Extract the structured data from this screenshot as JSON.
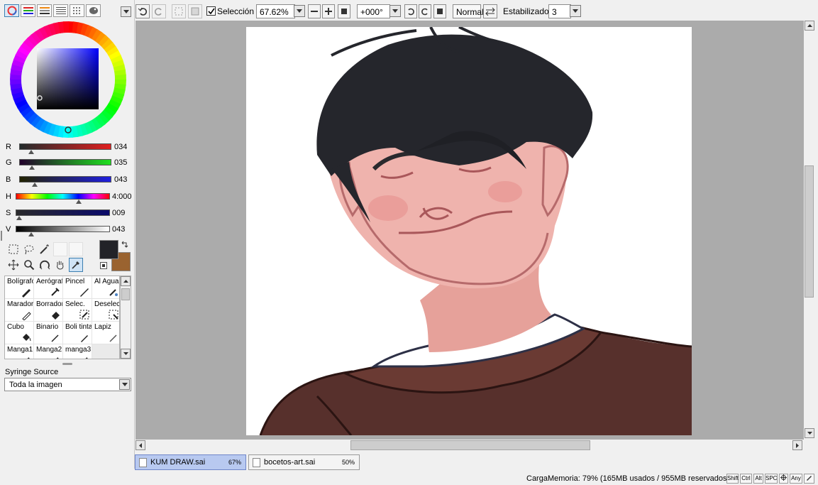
{
  "colors": {
    "panel_bg": "#f0f0f0",
    "canvas_bg": "#ababab",
    "foreground": "#222328",
    "background": "#9a6330",
    "active_tab": "#b8c9f0",
    "accent": "#3c7fb1"
  },
  "color_panel": {
    "mode_icons": [
      "color-wheel-icon",
      "rgb-slider-icon",
      "hsv-slider-icon",
      "swatch-list-icon",
      "scratchpad-icon",
      "palette-icon"
    ],
    "sliders": [
      {
        "label": "R",
        "value": "034",
        "level": 0.133
      },
      {
        "label": "G",
        "value": "035",
        "level": 0.137
      },
      {
        "label": "B",
        "value": "043",
        "level": 0.169
      },
      {
        "label": "H",
        "value": "4:000",
        "level": 0.667
      },
      {
        "label": "S",
        "value": "009",
        "level": 0.035
      },
      {
        "label": "V",
        "value": "043",
        "level": 0.169
      }
    ]
  },
  "tools": [
    "selection-rect-tool",
    "lasso-tool",
    "magic-wand-tool",
    "move-tool",
    "zoom-tool",
    "rotate-tool",
    "hand-tool",
    "eyedropper-tool"
  ],
  "brushes": [
    {
      "name": "Bolígrafo"
    },
    {
      "name": "Aerógrafo"
    },
    {
      "name": "Pincel"
    },
    {
      "name": "Al Agua"
    },
    {
      "name": "Marador"
    },
    {
      "name": "Borrador"
    },
    {
      "name": "Selec."
    },
    {
      "name": "Deselec."
    },
    {
      "name": "Cubo"
    },
    {
      "name": "Binario"
    },
    {
      "name": "Boli tinta"
    },
    {
      "name": "Lapiz"
    },
    {
      "name": "Manga1"
    },
    {
      "name": "Manga2"
    },
    {
      "name": "manga3"
    },
    {
      "name": ""
    }
  ],
  "syringe": {
    "label": "Syringe Source",
    "value": "Toda la imagen"
  },
  "toolbar": {
    "selection_label": "Selección",
    "zoom": "67.62%",
    "rotation": "+000°",
    "blend_mode": "Normal",
    "stabilizer_label": "Estabilizador",
    "stabilizer_value": "3"
  },
  "tabs": [
    {
      "name": "KUM DRAW.sai",
      "zoom": "67%",
      "active": true
    },
    {
      "name": "bocetos-art.sai",
      "zoom": "50%",
      "active": false
    }
  ],
  "status": {
    "memory": "CargaMemoria: 79% (165MB usados / 955MB reservados)",
    "keys": [
      "Shift",
      "Ctrl",
      "Alt",
      "SPC",
      "Any"
    ]
  }
}
